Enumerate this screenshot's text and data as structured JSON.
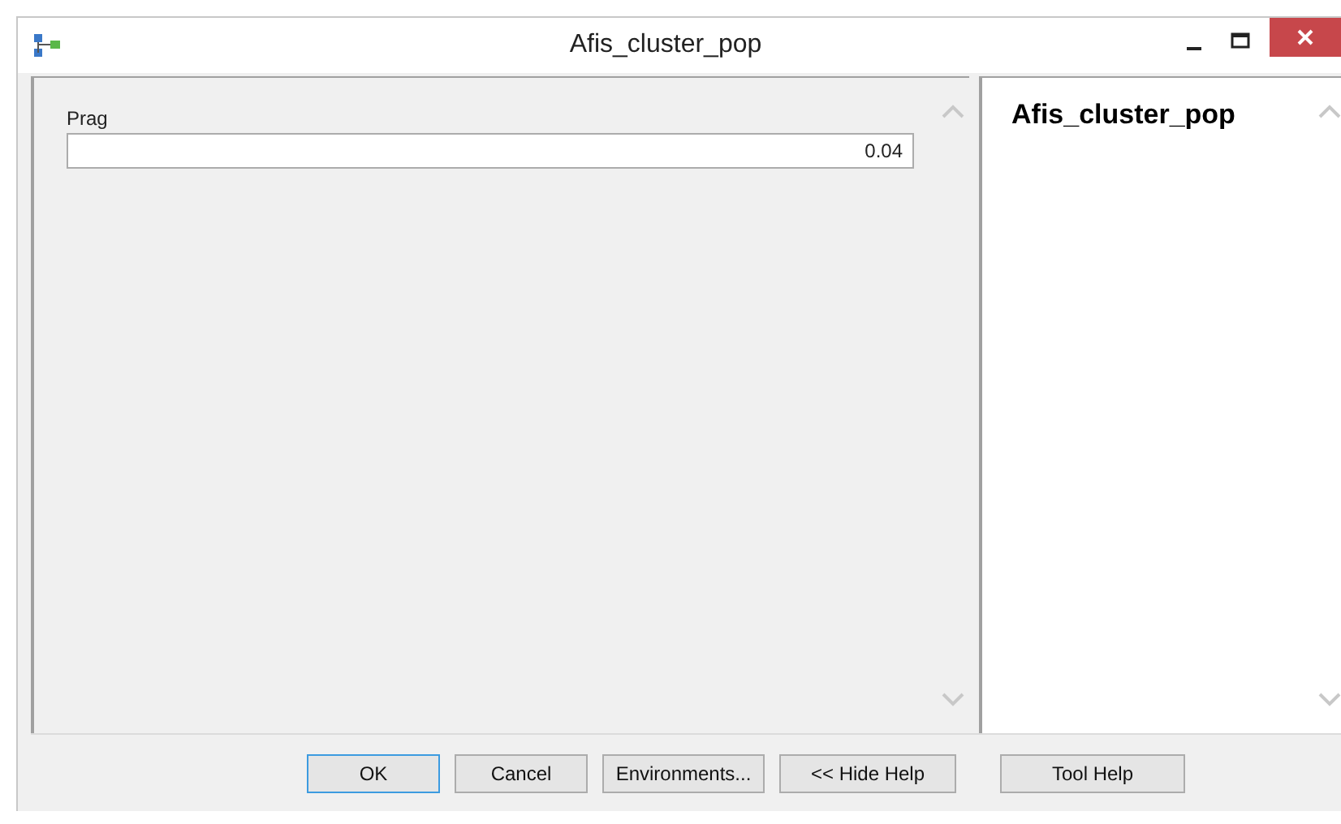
{
  "window": {
    "title": "Afis_cluster_pop"
  },
  "parameters": [
    {
      "label": "Prag",
      "value": "0.04"
    }
  ],
  "help": {
    "title": "Afis_cluster_pop"
  },
  "buttons": [
    {
      "label": "OK",
      "default": true
    },
    {
      "label": "Cancel",
      "default": false
    },
    {
      "label": "Environments...",
      "default": false
    },
    {
      "label": "<< Hide Help",
      "default": false
    },
    {
      "label": "Tool Help",
      "default": false
    }
  ]
}
